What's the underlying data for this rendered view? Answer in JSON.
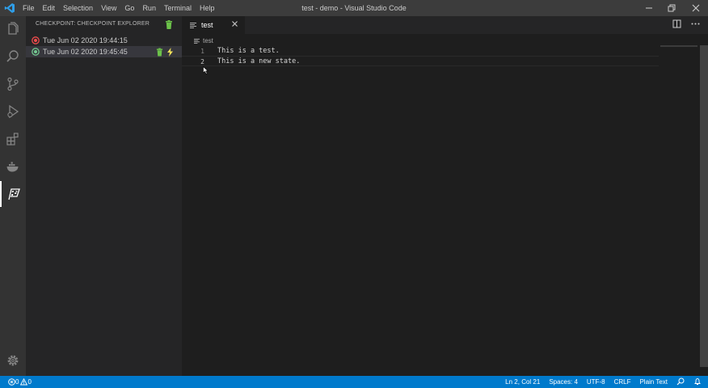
{
  "titlebar": {
    "menu": [
      "File",
      "Edit",
      "Selection",
      "View",
      "Go",
      "Run",
      "Terminal",
      "Help"
    ],
    "title": "test - demo - Visual Studio Code",
    "icons": [
      "vscode-logo",
      "minimize-icon",
      "restore-icon",
      "close-icon"
    ]
  },
  "activitybar": {
    "items": [
      "explorer-icon",
      "search-icon",
      "source-control-icon",
      "run-debug-icon",
      "extensions-icon",
      "docker-icon",
      "checkpoint-flag-icon"
    ],
    "bottom": "settings-gear-icon"
  },
  "sidebar": {
    "header": "CHECKPOINT: CHECKPOINT EXPLORER",
    "header_icon": "trash-icon",
    "checkpoints": [
      {
        "label": "Tue Jun 02 2020 19:44:15",
        "status_color": "#f14c4c",
        "selected": false
      },
      {
        "label": "Tue Jun 02 2020 19:45:45",
        "status_color": "#73c991",
        "selected": true
      }
    ]
  },
  "editor": {
    "tab": {
      "label": "test",
      "active": true
    },
    "tab_actions": [
      "split-editor-icon",
      "more-actions-icon"
    ],
    "breadcrumb": "test",
    "lines": [
      {
        "number": "1",
        "text": "This is a test."
      },
      {
        "number": "2",
        "text": "This is a new state."
      }
    ]
  },
  "statusbar": {
    "errors": "0",
    "warnings": "0",
    "position": "Ln 2, Col 21",
    "spaces": "Spaces: 4",
    "encoding": "UTF-8",
    "eol": "CRLF",
    "language": "Plain Text",
    "icons": [
      "feedback-icon",
      "bell-icon"
    ],
    "color": "#007acc"
  },
  "colors": {
    "accent": "#007acc",
    "trash": "#6cc24a",
    "lightning": "#f0e05a"
  }
}
